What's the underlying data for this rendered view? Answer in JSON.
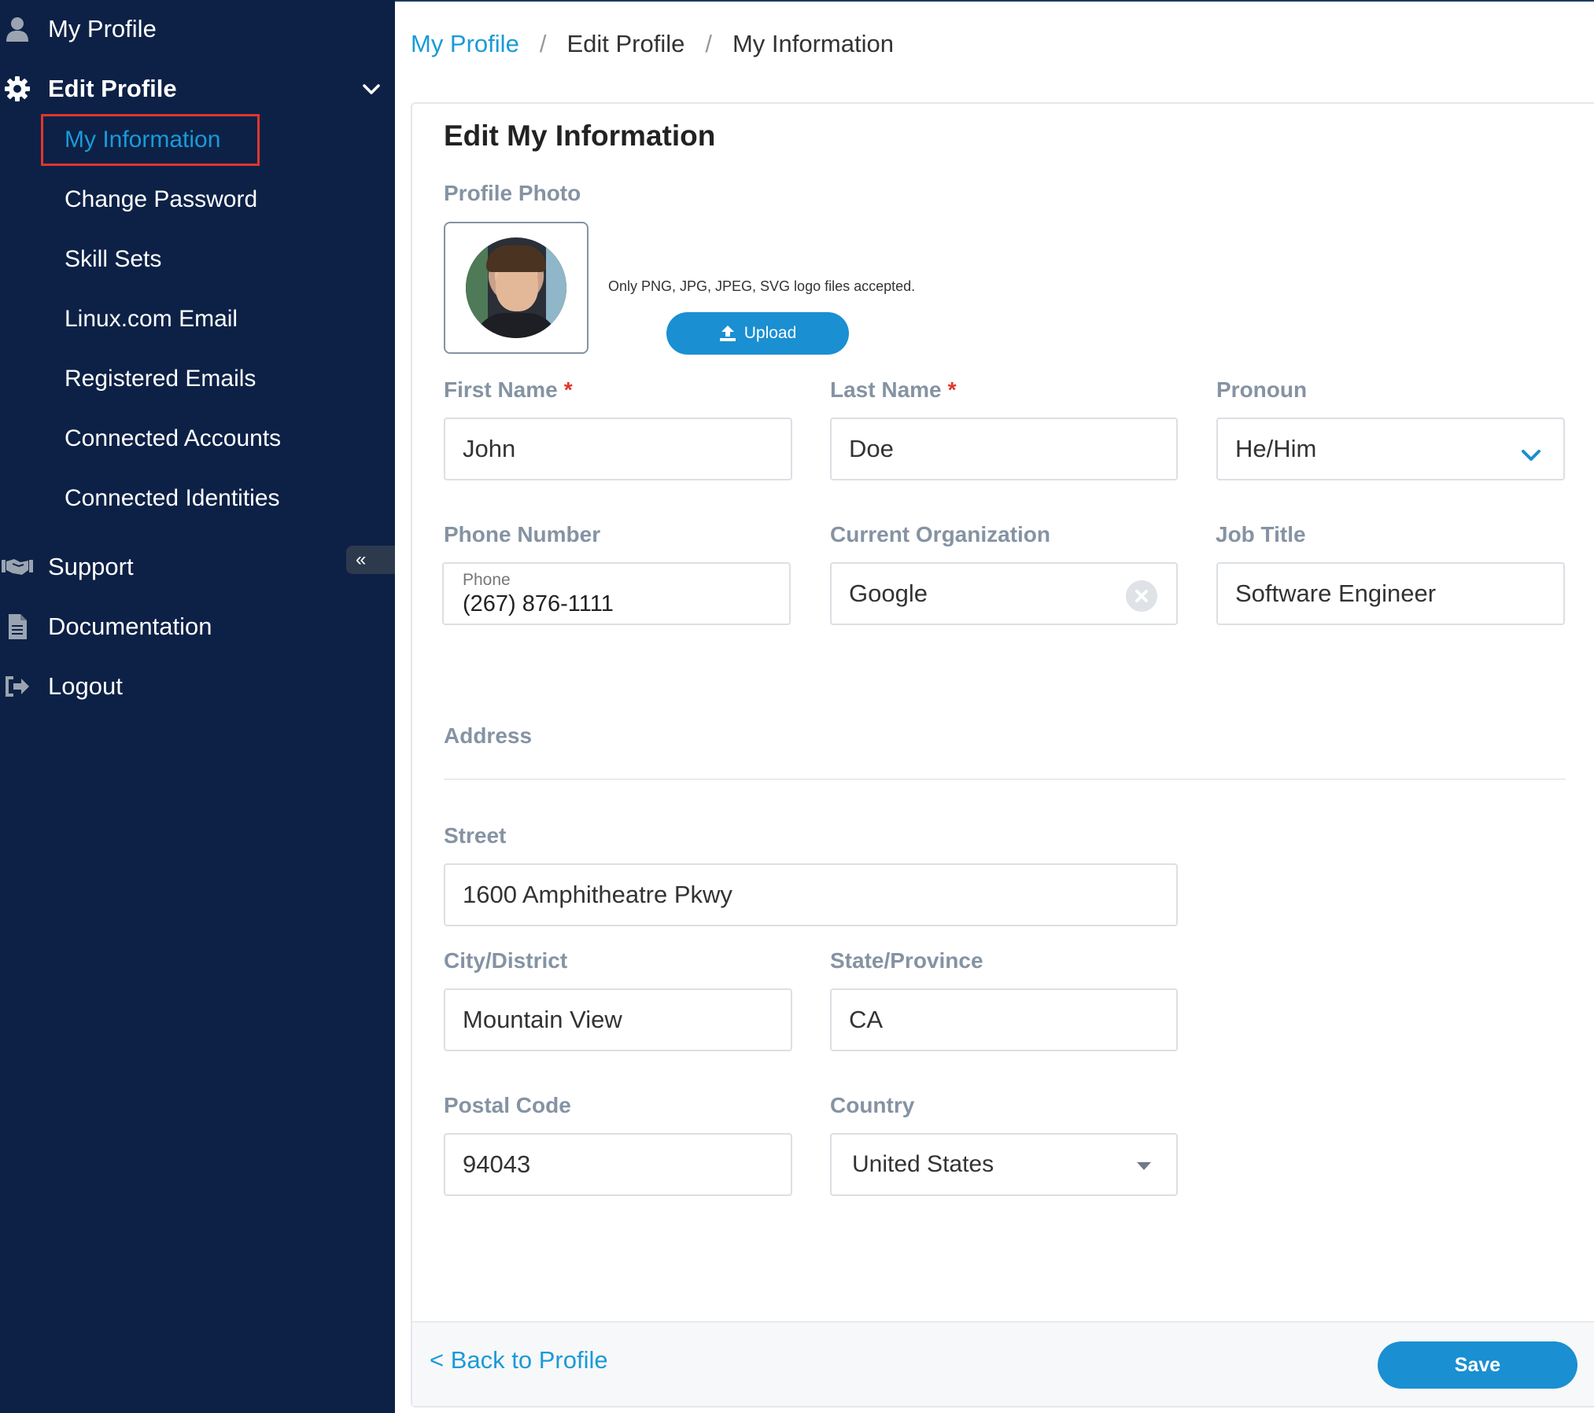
{
  "sidebar": {
    "my_profile": "My Profile",
    "edit_profile": "Edit Profile",
    "sub_items": [
      "My Information",
      "Change Password",
      "Skill Sets",
      "Linux.com Email",
      "Registered Emails",
      "Connected Accounts",
      "Connected Identities"
    ],
    "active_item": "My Information",
    "support": "Support",
    "documentation": "Documentation",
    "logout": "Logout",
    "collapse_glyph": "«"
  },
  "breadcrumb": [
    "My Profile",
    "Edit Profile",
    "My Information"
  ],
  "breadcrumb_sep": "/",
  "card": {
    "title": "Edit My Information",
    "profile_photo_label": "Profile Photo",
    "photo_note": "Only PNG, JPG, JPEG, SVG logo files accepted.",
    "upload_label": "Upload"
  },
  "form": {
    "required_mark": "*",
    "first_name": {
      "label": "First Name",
      "value": "John"
    },
    "last_name": {
      "label": "Last Name",
      "value": "Doe"
    },
    "pronoun": {
      "label": "Pronoun",
      "value": "He/Him"
    },
    "phone": {
      "label": "Phone Number",
      "inner_label": "Phone",
      "value": "(267) 876-1111"
    },
    "organization": {
      "label": "Current Organization",
      "value": "Google"
    },
    "job_title": {
      "label": "Job Title",
      "value": "Software Engineer"
    },
    "address_heading": "Address",
    "street": {
      "label": "Street",
      "value": "1600 Amphitheatre Pkwy"
    },
    "city": {
      "label": "City/District",
      "value": "Mountain View"
    },
    "state": {
      "label": "State/Province",
      "value": "CA"
    },
    "postal": {
      "label": "Postal Code",
      "value": "94043"
    },
    "country": {
      "label": "Country",
      "value": "United States"
    }
  },
  "footer": {
    "back_label": "< Back to Profile",
    "save_label": "Save"
  },
  "colors": {
    "sidebar_bg": "#0d2146",
    "accent": "#1a9ad9",
    "button": "#1a8fd1",
    "required": "#e0362c",
    "label": "#8593a3"
  },
  "icons": [
    "user-icon",
    "gear-icon",
    "chevron-down-icon",
    "handshake-icon",
    "document-icon",
    "logout-icon",
    "upload-icon",
    "clear-icon",
    "caret-down-icon"
  ]
}
